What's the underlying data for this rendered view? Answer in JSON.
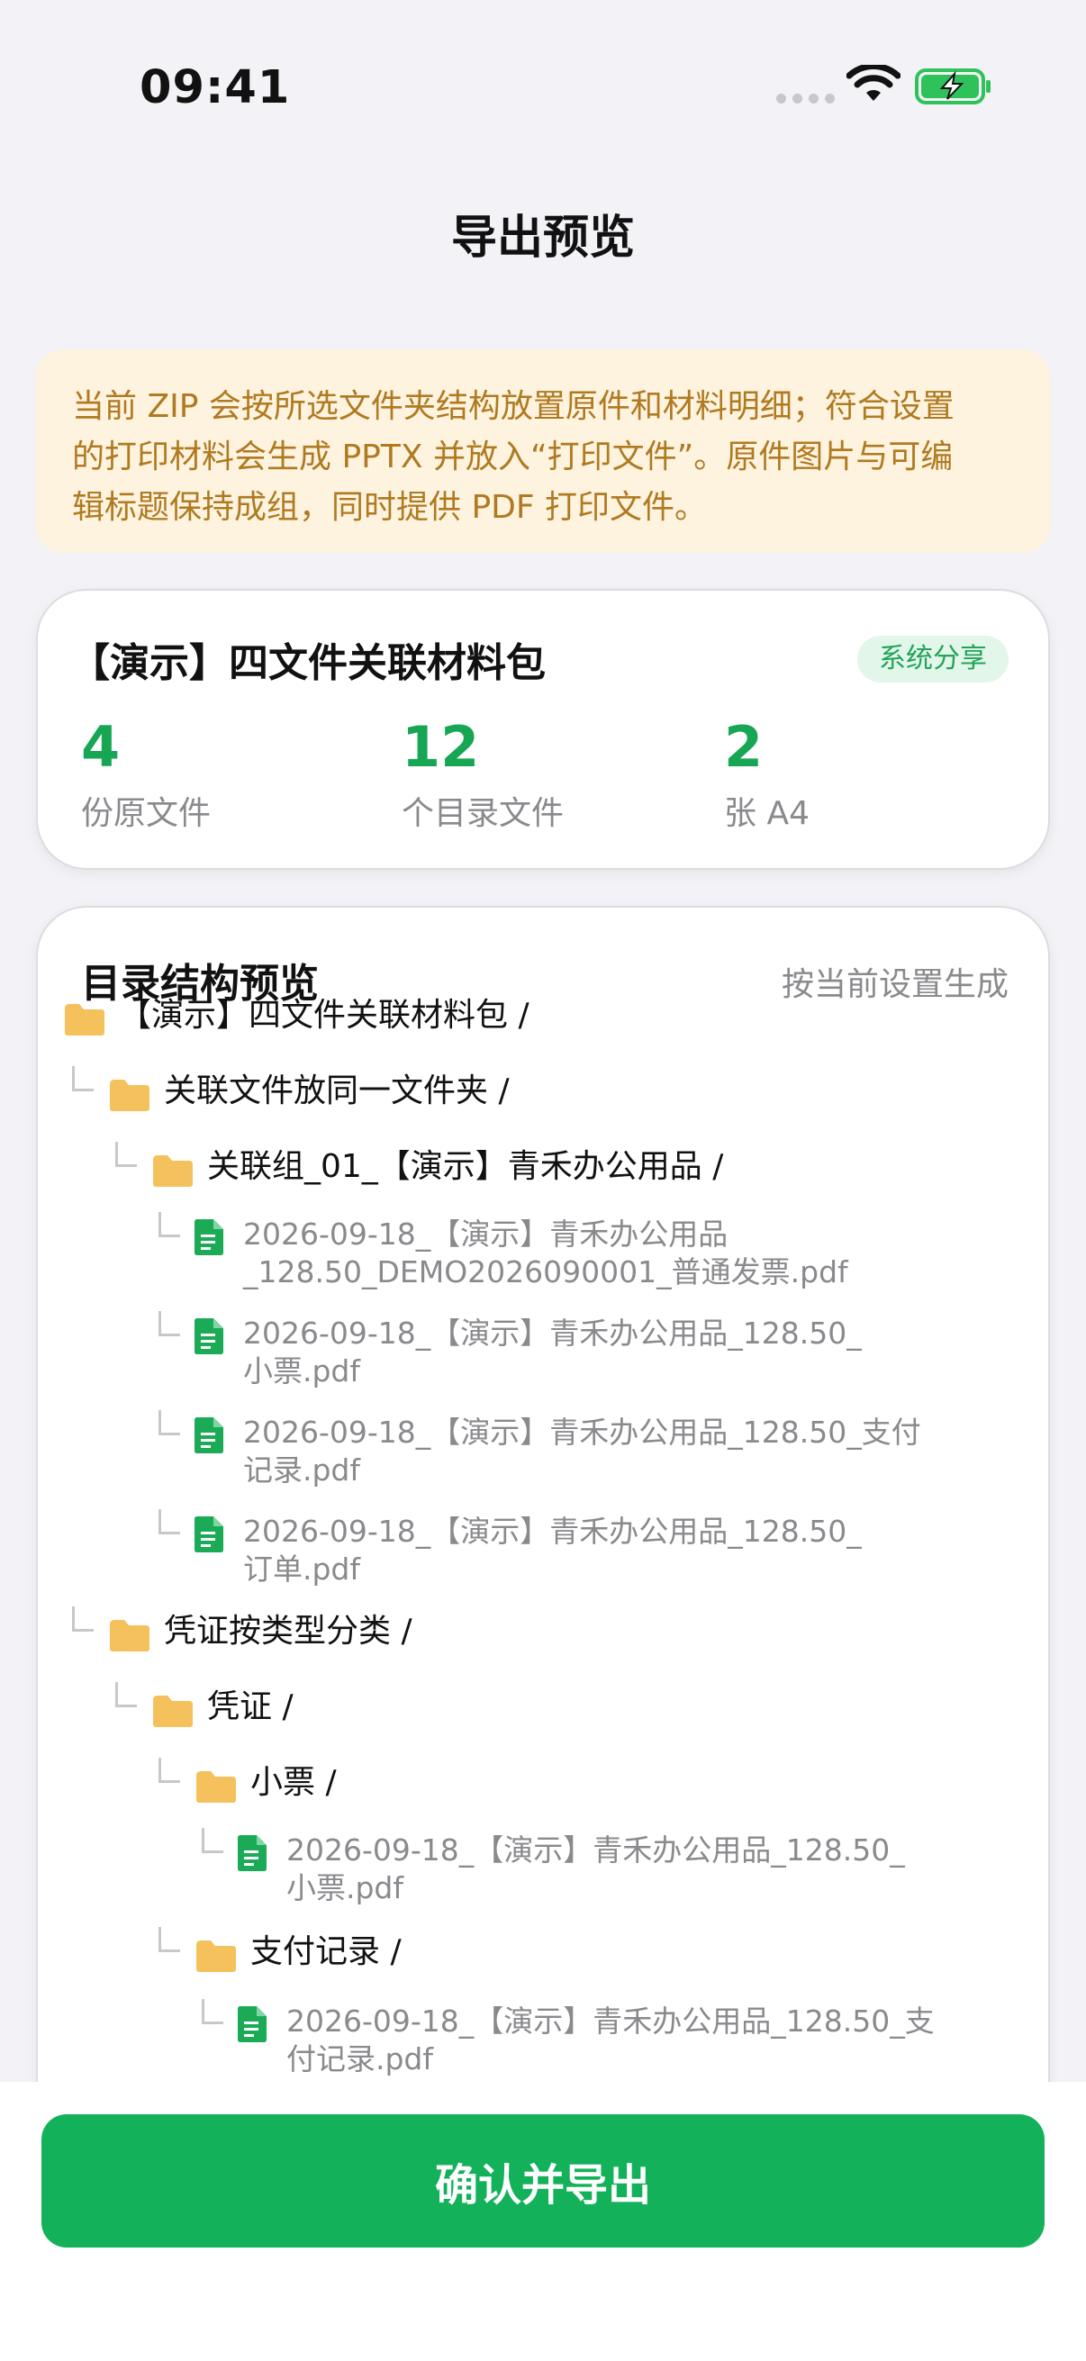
{
  "status_bar": {
    "time": "09:41"
  },
  "nav": {
    "title": "导出预览"
  },
  "notice": {
    "lines": [
      "当前 ZIP 会按所选文件夹结构放置原件和材料明细；符合设置",
      "的打印材料会生成 PPTX 并放入“打印文件”。原件图片与可编",
      "辑标题保持成组，同时提供 PDF 打印文件。"
    ]
  },
  "summary": {
    "title": "【演示】四文件关联材料包",
    "badge": "系统分享",
    "stats": [
      {
        "value": "4",
        "label": "份原文件"
      },
      {
        "value": "12",
        "label": "个目录文件"
      },
      {
        "value": "2",
        "label": "张 A4"
      }
    ]
  },
  "tree": {
    "title": "目录结构预览",
    "hint": "按当前设置生成",
    "nodes": [
      {
        "type": "folder",
        "depth": 0,
        "label": "【演示】四文件关联材料包 /"
      },
      {
        "type": "folder",
        "depth": 1,
        "label": "关联文件放同一文件夹 /"
      },
      {
        "type": "folder",
        "depth": 2,
        "label": "关联组_01_【演示】青禾办公用品 /"
      },
      {
        "type": "file",
        "depth": 3,
        "lines": [
          "2026-09-18_【演示】青禾办公用品",
          "_128.50_DEMO2026090001_普通发票.pdf"
        ]
      },
      {
        "type": "file",
        "depth": 3,
        "lines": [
          "2026-09-18_【演示】青禾办公用品_128.50_",
          "小票.pdf"
        ]
      },
      {
        "type": "file",
        "depth": 3,
        "lines": [
          "2026-09-18_【演示】青禾办公用品_128.50_支付",
          "记录.pdf"
        ]
      },
      {
        "type": "file",
        "depth": 3,
        "lines": [
          "2026-09-18_【演示】青禾办公用品_128.50_",
          "订单.pdf"
        ]
      },
      {
        "type": "folder",
        "depth": 1,
        "label": "凭证按类型分类 /"
      },
      {
        "type": "folder",
        "depth": 2,
        "label": "凭证 /"
      },
      {
        "type": "folder",
        "depth": 3,
        "label": "小票 /"
      },
      {
        "type": "file",
        "depth": 4,
        "lines": [
          "2026-09-18_【演示】青禾办公用品_128.50_",
          "小票.pdf"
        ]
      },
      {
        "type": "folder",
        "depth": 3,
        "label": "支付记录 /"
      },
      {
        "type": "file",
        "depth": 4,
        "lines": [
          "2026-09-18_【演示】青禾办公用品_128.50_支",
          "付记录.pdf"
        ]
      }
    ]
  },
  "footer": {
    "confirm_label": "确认并导出"
  },
  "colors": {
    "accent": "#13b25a",
    "folder": "#f5c15c",
    "doc": "#1bab57",
    "notice_bg": "#fdf3df",
    "notice_text": "#b07a20"
  },
  "icons": {
    "folder": "folder-icon",
    "file": "document-icon",
    "wifi": "wifi-icon",
    "battery": "battery-charging-icon"
  }
}
